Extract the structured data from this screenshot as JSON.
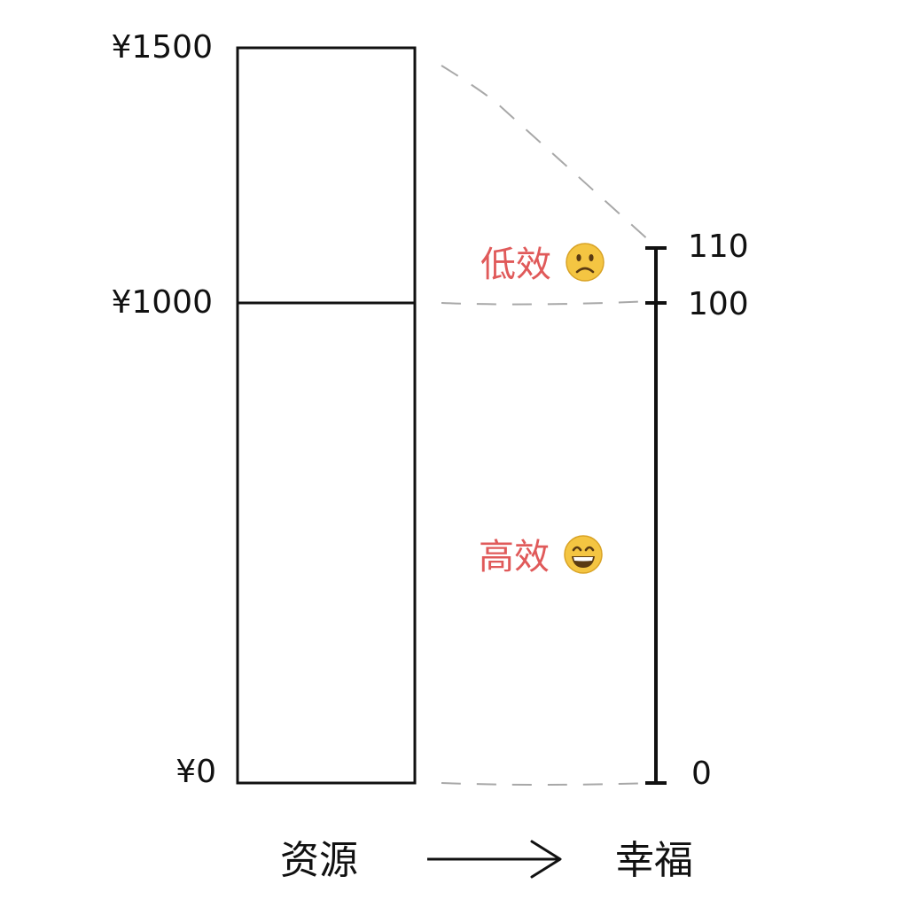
{
  "resource_column": {
    "ticks": [
      {
        "label": "¥1500",
        "value": 1500
      },
      {
        "label": "¥1000",
        "value": 1000
      },
      {
        "label": "¥0",
        "value": 0
      }
    ],
    "max_value": 1500
  },
  "happiness_scale": {
    "ticks": [
      {
        "label": "110",
        "value": 110
      },
      {
        "label": "100",
        "value": 100
      },
      {
        "label": "0",
        "value": 0
      }
    ],
    "max_value": 110
  },
  "regions": {
    "low": {
      "label": "低效",
      "emoji": "sad-face-icon"
    },
    "high": {
      "label": "高效",
      "emoji": "grinning-face-icon"
    }
  },
  "captions": {
    "left": "资源",
    "right": "幸福",
    "arrow": "right-arrow-icon"
  },
  "colors": {
    "region_text": "#e05a5a",
    "dashed_connector": "#a8a8a8",
    "emoji_face": "#f4c542",
    "stroke": "#111111"
  }
}
